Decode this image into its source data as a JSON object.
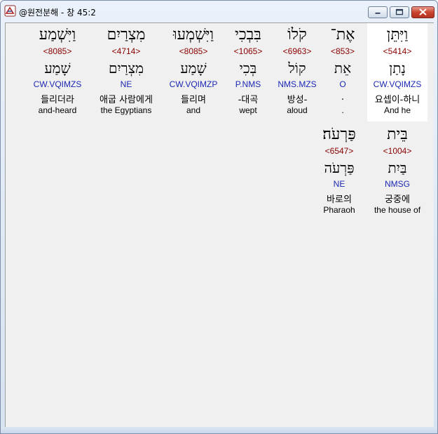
{
  "window": {
    "title": "@원전분해 - 창 45:2"
  },
  "rows": [
    {
      "words": [
        {
          "hebrew": "וַיִּתֵּן",
          "strong": "<5414>",
          "lemma": "נָתַן",
          "parse": "CW.VQIMZS",
          "korean": "요셉이-하니",
          "english": "And he",
          "highlighted": true
        },
        {
          "hebrew": "אֶת־",
          "strong": "<853>",
          "lemma": "אֵת",
          "parse": "O",
          "korean": ".",
          "english": ".",
          "highlighted": false
        },
        {
          "hebrew": "קֹלוֹ",
          "strong": "<6963>",
          "lemma": "קוֹל",
          "parse": "NMS.MZS",
          "korean": "방성-",
          "english": "aloud",
          "highlighted": false
        },
        {
          "hebrew": "בִּבְכִי",
          "strong": "<1065>",
          "lemma": "בְּכִי",
          "parse": "P.NMS",
          "korean": "-대곡",
          "english": "wept",
          "highlighted": false
        },
        {
          "hebrew": "וַיִּשְׁמְעוּ",
          "strong": "<8085>",
          "lemma": "שָׁמַע",
          "parse": "CW.VQIMZP",
          "korean": "들리며",
          "english": "and",
          "highlighted": false
        },
        {
          "hebrew": "מִצְרַיִם",
          "strong": "<4714>",
          "lemma": "מִצְרַיִם",
          "parse": "NE",
          "korean": "애굽 사람에게",
          "english": "the Egyptians",
          "highlighted": false
        },
        {
          "hebrew": "וַיִּשְׁמַע",
          "strong": "<8085>",
          "lemma": "שָׁמַע",
          "parse": "CW.VQIMZS",
          "korean": "들리더라",
          "english": "and-heard",
          "highlighted": false
        }
      ]
    },
    {
      "words": [
        {
          "hebrew": "בֵּית",
          "strong": "<1004>",
          "lemma": "בַּיִת",
          "parse": "NMSG",
          "korean": "궁중에",
          "english": "the house of",
          "highlighted": false
        },
        {
          "hebrew": "פַּרְעֹה׃",
          "strong": "<6547>",
          "lemma": "פַּרְעֹה",
          "parse": "NE",
          "korean": "바로의",
          "english": "Pharaoh",
          "highlighted": false
        }
      ]
    }
  ]
}
